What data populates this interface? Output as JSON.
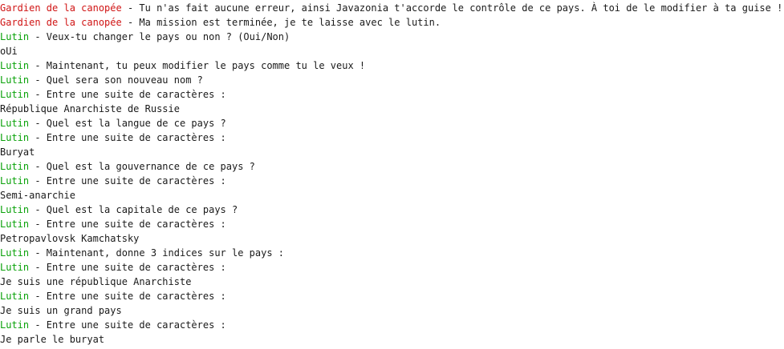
{
  "colors": {
    "text": "#1a1a1a",
    "guardian": "#d01515",
    "lutin": "#0aa20a",
    "background": "#ffffff"
  },
  "console": {
    "lines": [
      {
        "speaker": "Gardien de la canopée",
        "speaker_color": "red",
        "text": " - Tu n'as fait aucune erreur, ainsi Javazonia t'accorde le contrôle de ce pays. À toi de le modifier à ta guise !"
      },
      {
        "speaker": "Gardien de la canopée",
        "speaker_color": "red",
        "text": " - Ma mission est terminée, je te laisse avec le lutin."
      },
      {
        "speaker": "Lutin",
        "speaker_color": "green",
        "text": " - Veux-tu changer le pays ou non ? (Oui/Non)"
      },
      {
        "speaker": "",
        "speaker_color": "",
        "text": "oUi"
      },
      {
        "speaker": "Lutin",
        "speaker_color": "green",
        "text": " - Maintenant, tu peux modifier le pays comme tu le veux !"
      },
      {
        "speaker": "Lutin",
        "speaker_color": "green",
        "text": " - Quel sera son nouveau nom ?"
      },
      {
        "speaker": "Lutin",
        "speaker_color": "green",
        "text": " - Entre une suite de caractères :"
      },
      {
        "speaker": "",
        "speaker_color": "",
        "text": "République Anarchiste de Russie"
      },
      {
        "speaker": "Lutin",
        "speaker_color": "green",
        "text": " - Quel est la langue de ce pays ?"
      },
      {
        "speaker": "Lutin",
        "speaker_color": "green",
        "text": " - Entre une suite de caractères :"
      },
      {
        "speaker": "",
        "speaker_color": "",
        "text": "Buryat"
      },
      {
        "speaker": "Lutin",
        "speaker_color": "green",
        "text": " - Quel est la gouvernance de ce pays ?"
      },
      {
        "speaker": "Lutin",
        "speaker_color": "green",
        "text": " - Entre une suite de caractères :"
      },
      {
        "speaker": "",
        "speaker_color": "",
        "text": "Semi-anarchie"
      },
      {
        "speaker": "Lutin",
        "speaker_color": "green",
        "text": " - Quel est la capitale de ce pays ?"
      },
      {
        "speaker": "Lutin",
        "speaker_color": "green",
        "text": " - Entre une suite de caractères :"
      },
      {
        "speaker": "",
        "speaker_color": "",
        "text": "Petropavlovsk Kamchatsky"
      },
      {
        "speaker": "Lutin",
        "speaker_color": "green",
        "text": " - Maintenant, donne 3 indices sur le pays :"
      },
      {
        "speaker": "Lutin",
        "speaker_color": "green",
        "text": " - Entre une suite de caractères :"
      },
      {
        "speaker": "",
        "speaker_color": "",
        "text": "Je suis une république Anarchiste"
      },
      {
        "speaker": "Lutin",
        "speaker_color": "green",
        "text": " - Entre une suite de caractères :"
      },
      {
        "speaker": "",
        "speaker_color": "",
        "text": "Je suis un grand pays"
      },
      {
        "speaker": "Lutin",
        "speaker_color": "green",
        "text": " - Entre une suite de caractères :"
      },
      {
        "speaker": "",
        "speaker_color": "",
        "text": "Je parle le buryat"
      }
    ]
  }
}
